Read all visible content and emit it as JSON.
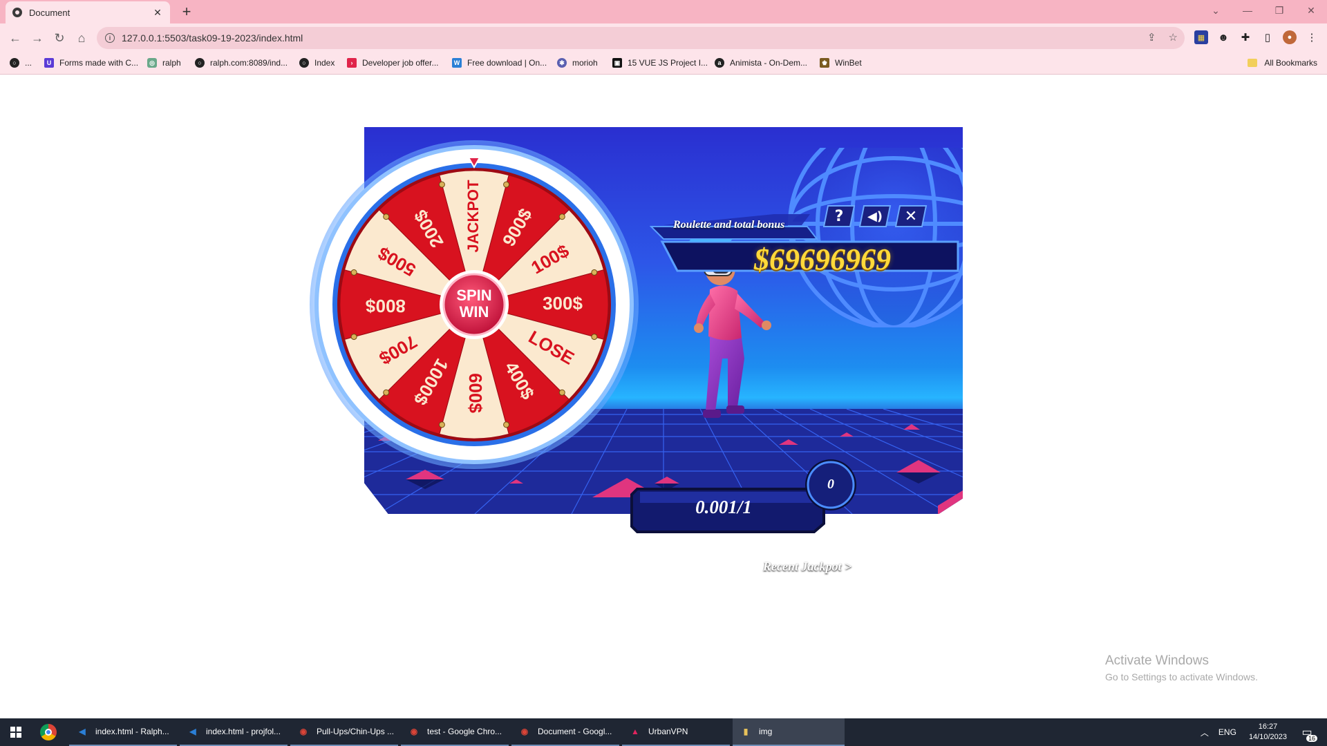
{
  "browser": {
    "tab_title": "Document",
    "url": "127.0.0.1:5503/task09-19-2023/index.html",
    "bookmarks": [
      {
        "label": "...",
        "color": "#222222",
        "glyph": "○"
      },
      {
        "label": "Forms made with C...",
        "color": "#5b3bd6",
        "glyph": "U"
      },
      {
        "label": "ralph",
        "color": "#6aa88a",
        "glyph": "◎"
      },
      {
        "label": "ralph.com:8089/ind...",
        "color": "#222222",
        "glyph": "○"
      },
      {
        "label": "Index",
        "color": "#222222",
        "glyph": "○"
      },
      {
        "label": "Developer job offer...",
        "color": "#e0244a",
        "glyph": "›"
      },
      {
        "label": "Free download | On...",
        "color": "#2a7fd6",
        "glyph": "W"
      },
      {
        "label": "morioh",
        "color": "#5a5fb0",
        "glyph": "✱"
      },
      {
        "label": "15 VUE JS Project I...",
        "color": "#111111",
        "glyph": "▣"
      },
      {
        "label": "Animista - On-Dem...",
        "color": "#222222",
        "glyph": "a"
      },
      {
        "label": "WinBet",
        "color": "#7a5a20",
        "glyph": "♚"
      }
    ],
    "all_bookmarks": "All Bookmarks"
  },
  "game": {
    "title": "Roulette and total bonus",
    "bonus_amount": "$69696969",
    "bet_value": "0.001/1",
    "spin_count": "0",
    "recent_jackpot": "Recent Jackpot >",
    "spin_label_1": "SPIN",
    "spin_label_2": "WIN",
    "wheel_segments": [
      "JACKPOT",
      "900$",
      "100$",
      "300$",
      "LOSE",
      "400$",
      "600$",
      "1000$",
      "700$",
      "800$",
      "500$",
      "200$"
    ],
    "colors": {
      "red": "#d8121f",
      "cream": "#fbe9cf",
      "gold": "#ffd93b",
      "accent_blue": "#2d56e8"
    }
  },
  "watermark": {
    "line1": "Activate Windows",
    "line2": "Go to Settings to activate Windows."
  },
  "taskbar": {
    "items": [
      {
        "label": "index.html - Ralph...",
        "color": "#2b7fd6",
        "glyph": "◀"
      },
      {
        "label": "index.html - projfol...",
        "color": "#2b7fd6",
        "glyph": "◀"
      },
      {
        "label": "Pull-Ups/Chin-Ups ...",
        "color": "#db4437",
        "glyph": "◉"
      },
      {
        "label": "test - Google Chro...",
        "color": "#db4437",
        "glyph": "◉"
      },
      {
        "label": "Document - Googl...",
        "color": "#db4437",
        "glyph": "◉"
      },
      {
        "label": "UrbanVPN",
        "color": "#e0245e",
        "glyph": "▲"
      },
      {
        "label": "img",
        "color": "#e8c25b",
        "glyph": "▮"
      }
    ],
    "language": "ENG",
    "time": "16:27",
    "date": "14/10/2023",
    "notifications": "16"
  }
}
